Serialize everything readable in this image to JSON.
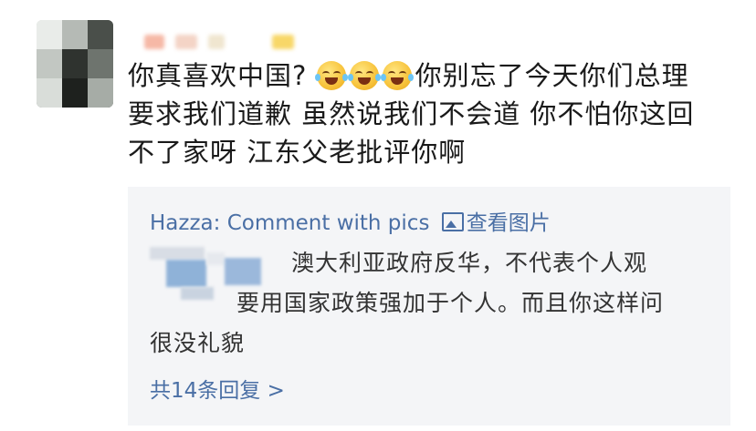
{
  "comment": {
    "lines": [
      "你别忘了今天你们总理",
      "要求我们道歉 虽然说我们不会道  你不怕你这回",
      "不了家呀  江东父老批评你啊"
    ],
    "prefix": "你真喜欢中国?",
    "emoji_name": "laughing-crying-emoji"
  },
  "reply_box": {
    "author": "Hazza",
    "preview": ": Comment with pics",
    "view_pic_label": "查看图片",
    "reply_lines": [
      "澳大利亚政府反华，不代表个人观",
      "要用国家政策强加于个人。而且你这样问",
      "很没礼貌"
    ],
    "more_replies": "共14条回复 >"
  },
  "colors": {
    "link": "#4a6fa5",
    "text": "#1a1a1a",
    "reply_bg": "#f4f5f7"
  }
}
